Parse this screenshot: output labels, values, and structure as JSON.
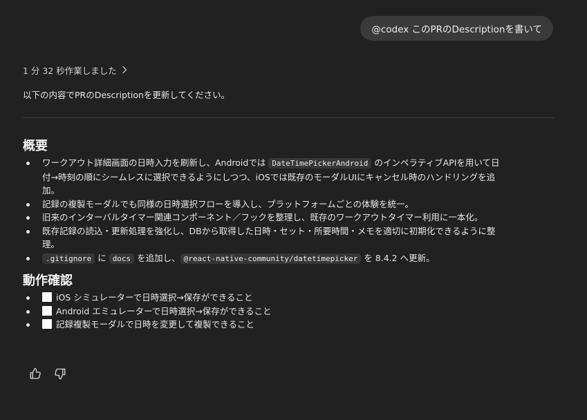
{
  "user_message": "@codex このPRのDescriptionを書いて",
  "worked_text": "1 分 32 秒作業しました",
  "intro": "以下の内容でPRのDescriptionを更新してください。",
  "overview": {
    "heading": "概要",
    "items": [
      {
        "t1": "ワークアウト詳細画面の日時入力を刷新し、Androidでは ",
        "code1": "DateTimePickerAndroid",
        "t2": " のインペラティブAPIを用いて日",
        "t3": "付→時刻の順にシームレスに選択できるようにしつつ、iOSでは既存のモーダルUIにキャンセル時のハンドリングを追",
        "t4": "加。"
      },
      {
        "text": "記録の複製モーダルでも同様の日時選択フローを導入し、プラットフォームごとの体験を統一。"
      },
      {
        "text": "旧来のインターバルタイマー関連コンポーネント／フックを整理し、既存のワークアウトタイマー利用に一本化。"
      },
      {
        "t1": "既存記録の読込・更新処理を強化し、DBから取得した日時・セット・所要時間・メモを適切に初期化できるように整",
        "t2": "理。"
      },
      {
        "code1": ".gitignore",
        "t1": " に ",
        "code2": "docs",
        "t2": " を追加し、",
        "code3": "@react-native-community/datetimepicker",
        "t3": " を 8.4.2 へ更新。"
      }
    ]
  },
  "verification": {
    "heading": "動作確認",
    "items": [
      {
        "label": "iOS シミュレーターで日時選択→保存ができること",
        "checked": false
      },
      {
        "label": "Android エミュレーターで日時選択→保存ができること",
        "checked": false
      },
      {
        "label": "記録複製モーダルで日時を変更して複製できること",
        "checked": false
      }
    ]
  },
  "icons": {
    "worked_chevron": "chevron-right-icon",
    "like": "thumbs-up-icon",
    "dislike": "thumbs-down-icon"
  }
}
